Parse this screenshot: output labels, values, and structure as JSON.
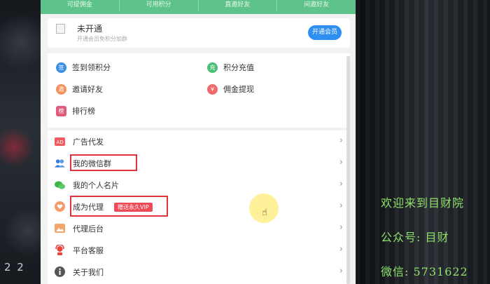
{
  "stats": [
    "可提佣金",
    "可用积分",
    "直邀好友",
    "间邀好友"
  ],
  "member": {
    "title": "未开通",
    "subtitle": "开通会员免积分加群",
    "button": "开通会员"
  },
  "quick": [
    {
      "label": "签到领积分",
      "icon": "calendar-icon",
      "glyph": "签",
      "color": "#3a8ee6"
    },
    {
      "label": "积分充值",
      "icon": "recharge-icon",
      "glyph": "充",
      "color": "#4bbf73"
    },
    {
      "label": "邀请好友",
      "icon": "invite-icon",
      "glyph": "邀",
      "color": "#f2935c"
    },
    {
      "label": "佣金提现",
      "icon": "withdraw-icon",
      "glyph": "¥",
      "color": "#ef6a6a"
    },
    {
      "label": "排行榜",
      "icon": "ranking-icon",
      "glyph": "榜",
      "color": "#e05a7a"
    }
  ],
  "menu": [
    {
      "label": "广告代发",
      "icon": "ad-icon"
    },
    {
      "label": "我的微信群",
      "icon": "group-icon"
    },
    {
      "label": "我的个人名片",
      "icon": "wechat-icon"
    },
    {
      "label": "成为代理",
      "icon": "heart-icon",
      "badge": "赠送永久VIP"
    },
    {
      "label": "代理后台",
      "icon": "image-icon"
    },
    {
      "label": "平台客服",
      "icon": "service-icon"
    },
    {
      "label": "关于我们",
      "icon": "info-icon"
    }
  ],
  "promo": [
    "欢迎来到目财院",
    "公众号: 目财",
    "微信: 5731622"
  ],
  "left_deco": "2 2"
}
